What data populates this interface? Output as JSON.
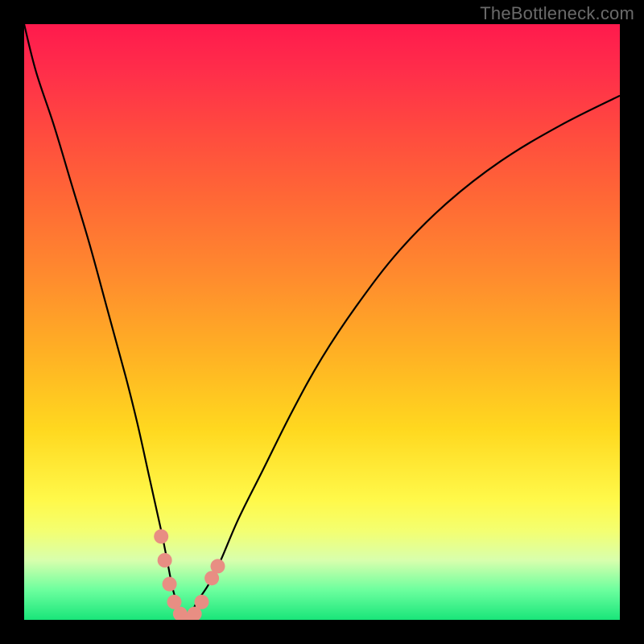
{
  "watermark": "TheBottleneck.com",
  "colors": {
    "frame": "#000000",
    "curve": "#000000",
    "marker": "#e88e83",
    "gradient_stops": [
      "#ff1a4d",
      "#ff2e4a",
      "#ff4a3f",
      "#ff6a35",
      "#ff8a2e",
      "#ffb024",
      "#ffd81f",
      "#fff94a",
      "#f4ff70",
      "#d8ffad",
      "#6cff9e",
      "#19e57a"
    ]
  },
  "chart_data": {
    "type": "line",
    "title": "",
    "xlabel": "",
    "ylabel": "",
    "xlim": [
      0,
      100
    ],
    "ylim": [
      0,
      100
    ],
    "y_axis_inverted_meaning": "lower y = better (green); higher y = worse (red)",
    "notch_x": 27,
    "series": [
      {
        "name": "bottleneck-curve",
        "x": [
          0,
          2,
          5,
          8,
          11,
          14,
          17,
          19,
          21,
          23,
          24,
          25,
          26,
          27,
          28,
          29,
          31,
          33,
          36,
          40,
          45,
          50,
          56,
          63,
          71,
          80,
          90,
          100
        ],
        "y": [
          100,
          92,
          83,
          73,
          63,
          52,
          41,
          33,
          24,
          15,
          10,
          5,
          2,
          0,
          1,
          3,
          6,
          10,
          17,
          25,
          35,
          44,
          53,
          62,
          70,
          77,
          83,
          88
        ]
      }
    ],
    "markers": {
      "name": "highlighted-points",
      "points": [
        {
          "x": 23.0,
          "y": 14
        },
        {
          "x": 23.6,
          "y": 10
        },
        {
          "x": 24.4,
          "y": 6
        },
        {
          "x": 25.2,
          "y": 3
        },
        {
          "x": 26.2,
          "y": 1
        },
        {
          "x": 27.3,
          "y": 0
        },
        {
          "x": 28.6,
          "y": 1
        },
        {
          "x": 29.8,
          "y": 3
        },
        {
          "x": 31.5,
          "y": 7
        },
        {
          "x": 32.5,
          "y": 9
        }
      ],
      "radius_px": 9
    }
  }
}
